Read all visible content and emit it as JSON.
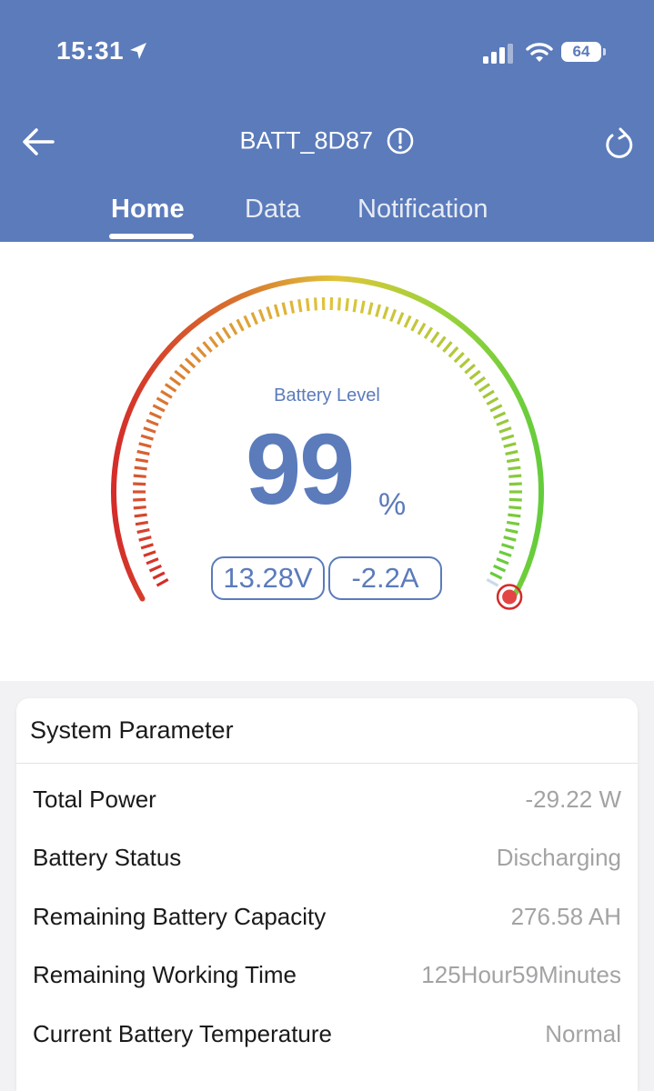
{
  "status_bar": {
    "time": "15:31",
    "battery_percent": "64"
  },
  "header": {
    "title": "BATT_8D87"
  },
  "tabs": [
    {
      "label": "Home",
      "active": true
    },
    {
      "label": "Data",
      "active": false
    },
    {
      "label": "Notification",
      "active": false
    }
  ],
  "gauge": {
    "caption": "Battery Level",
    "value": "99",
    "unit": "%",
    "level_fraction": 0.99,
    "voltage": "13.28V",
    "current": "-2.2A",
    "colors": {
      "low": "#d42a2a",
      "mid": "#e0c43a",
      "high": "#62cc3c",
      "text": "#5b7bbb"
    }
  },
  "system_parameter": {
    "title": "System Parameter",
    "rows": [
      {
        "label": "Total Power",
        "value": "-29.22 W"
      },
      {
        "label": "Battery Status",
        "value": "Discharging"
      },
      {
        "label": "Remaining Battery Capacity",
        "value": "276.58 AH"
      },
      {
        "label": "Remaining Working Time",
        "value": "125Hour59Minutes"
      },
      {
        "label": "Current Battery Temperature",
        "value": "Normal"
      }
    ]
  },
  "theme": {
    "header_bg": "#5b7bbb",
    "page_bg": "#f2f2f4"
  }
}
